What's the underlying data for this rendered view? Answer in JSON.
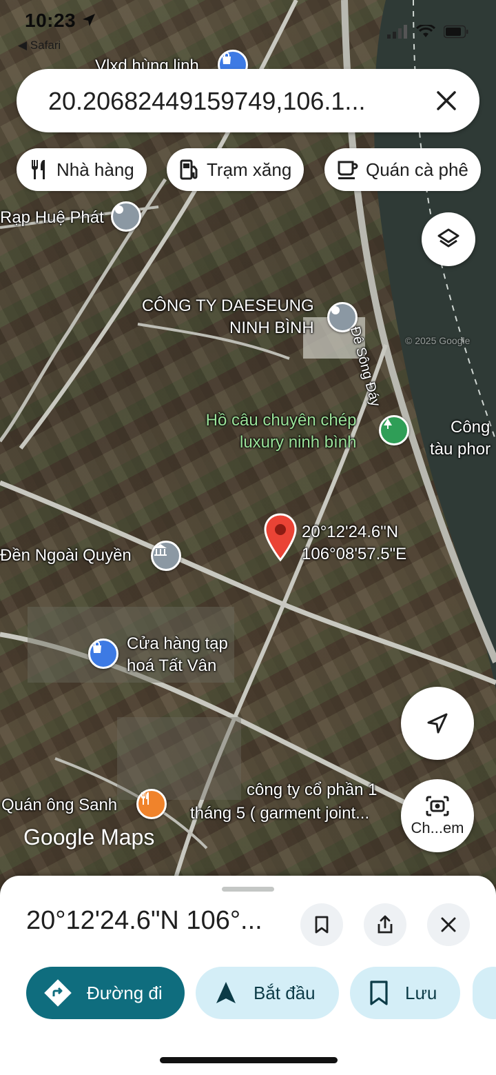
{
  "status_bar": {
    "time": "10:23",
    "back_label": "Safari"
  },
  "search": {
    "query": "20.20682449159749,106.1..."
  },
  "chips": [
    {
      "label": "Nhà hàng",
      "icon": "fork-knife-icon"
    },
    {
      "label": "Trạm xăng",
      "icon": "gas-station-icon"
    },
    {
      "label": "Quán cà phê",
      "icon": "coffee-cup-icon"
    }
  ],
  "map": {
    "labels": {
      "vlxd": "Vlxd hùng linh",
      "rap": "Rạp Huệ Phát",
      "daeseung_1": "CÔNG TY DAESEUNG",
      "daeseung_2": "NINH BÌNH",
      "road": "Đê Sông Đáy",
      "hocau_1": "Hồ câu chuyên chép",
      "hocau_2": "luxury ninh bình",
      "cong_1": "Công",
      "cong_2": "tàu phor",
      "pin_coord_1": "20°12'24.6\"N",
      "pin_coord_2": "106°08'57.5\"E",
      "den": "Đền Ngoài Quyền",
      "cuahang_1": "Cửa hàng tạp",
      "cuahang_2": "hoá Tất Vân",
      "quan": "Quán ông Sanh",
      "congty_1": "công ty cổ phần 1",
      "congty_2": "tháng 5 ( garment joint...",
      "watermark": "© 2025 Google"
    },
    "logo_google": "Google",
    "logo_maps": "Maps",
    "lens_label": "Ch...em"
  },
  "sheet": {
    "title": "20°12'24.6\"N 106°...",
    "actions": [
      {
        "label": "Đường đi",
        "icon": "directions-icon"
      },
      {
        "label": "Bắt đầu",
        "icon": "navigation-arrow-icon"
      },
      {
        "label": "Lưu",
        "icon": "bookmark-icon"
      }
    ]
  },
  "colors": {
    "primary": "#0f6d7e",
    "light_action": "#d4eef7",
    "pin": "#ea4335"
  }
}
